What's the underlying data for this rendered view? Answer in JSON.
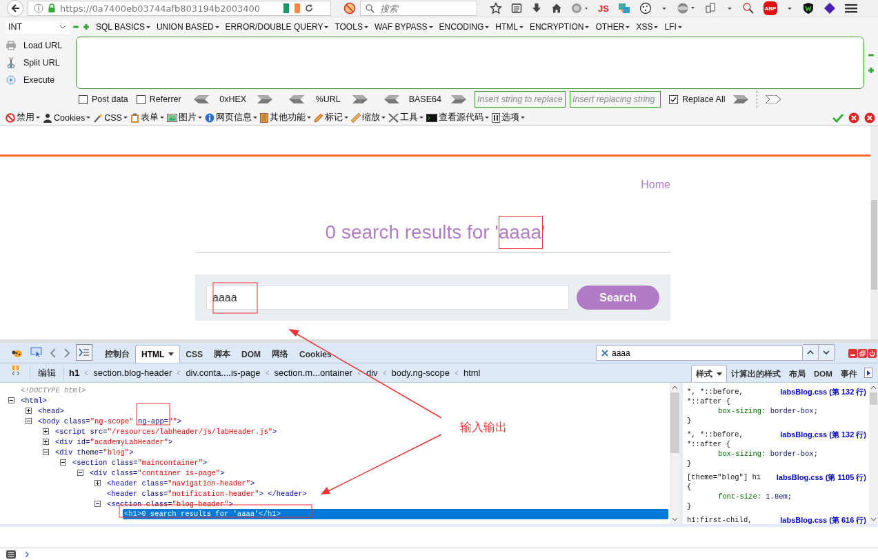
{
  "browser": {
    "url": "https://0a7400eb03744afb803194b2003400",
    "search_placeholder": "搜索",
    "addon_labels": [
      "JS",
      "ABP"
    ]
  },
  "hackbar": {
    "type_select": "INT",
    "menus": [
      "SQL BASICS",
      "UNION BASED",
      "ERROR/DOUBLE QUERY",
      "TOOLS",
      "WAF BYPASS",
      "ENCODING",
      "HTML",
      "ENCRYPTION",
      "OTHER",
      "XSS",
      "LFI"
    ],
    "actions": [
      {
        "label": "Load URL",
        "kind": "load"
      },
      {
        "label": "Split URL",
        "kind": "split"
      },
      {
        "label": "Execute",
        "kind": "execute"
      }
    ],
    "checkboxes": [
      {
        "label": "Post data",
        "checked": false
      },
      {
        "label": "Referrer",
        "checked": false
      }
    ],
    "encoders": [
      "0xHEX",
      "%URL",
      "BASE64"
    ],
    "replace_placeholders": [
      "Insert string to replace",
      "Insert replacing string"
    ],
    "replace_all": {
      "label": "Replace All",
      "checked": true
    }
  },
  "webdev_toolbar": [
    {
      "label": "禁用",
      "kind": "disable"
    },
    {
      "label": "Cookies",
      "kind": "cookies"
    },
    {
      "label": "CSS",
      "kind": "css"
    },
    {
      "label": "表单",
      "kind": "forms"
    },
    {
      "label": "图片",
      "kind": "images"
    },
    {
      "label": "网页信息",
      "kind": "info"
    },
    {
      "label": "其他功能",
      "kind": "misc"
    },
    {
      "label": "标记",
      "kind": "outline"
    },
    {
      "label": "缩放",
      "kind": "resize"
    },
    {
      "label": "工具",
      "kind": "tools"
    },
    {
      "label": "查看源代码",
      "kind": "source"
    },
    {
      "label": "选项",
      "kind": "options"
    }
  ],
  "page": {
    "nav_link": "Home",
    "heading": "0 search results for 'aaaa'",
    "search_value": "aaaa",
    "search_button": "Search"
  },
  "devtools": {
    "tabs": [
      {
        "label": "控制台",
        "selected": false,
        "menu": false
      },
      {
        "label": "HTML",
        "selected": true,
        "menu": true
      },
      {
        "label": "CSS",
        "selected": false,
        "menu": false
      },
      {
        "label": "脚本",
        "selected": false,
        "menu": false
      },
      {
        "label": "DOM",
        "selected": false,
        "menu": false
      },
      {
        "label": "网络",
        "selected": false,
        "menu": false
      },
      {
        "label": "Cookies",
        "selected": false,
        "menu": false
      }
    ],
    "search_value": "aaaa",
    "edit_button": "编辑",
    "breadcrumbs": [
      {
        "label": "h1",
        "selected": true
      },
      {
        "label": "section.blog-header",
        "selected": false
      },
      {
        "label": "div.conta....is-page",
        "selected": false
      },
      {
        "label": "section.m...ontainer",
        "selected": false
      },
      {
        "label": "div",
        "selected": false
      },
      {
        "label": "body.ng-scope",
        "selected": false
      },
      {
        "label": "html",
        "selected": false
      }
    ],
    "side_tabs": [
      {
        "label": "样式",
        "selected": true,
        "menu": true
      },
      {
        "label": "计算出的样式",
        "selected": false,
        "menu": false
      },
      {
        "label": "布局",
        "selected": false,
        "menu": false
      },
      {
        "label": "DOM",
        "selected": false,
        "menu": false
      },
      {
        "label": "事件",
        "selected": false,
        "menu": false
      }
    ],
    "tree": [
      {
        "line": [
          {
            "text": "<!DOCTYPE html>",
            "kind": "doctype"
          }
        ],
        "selected": false
      },
      {
        "line": [
          {
            "text": "<html>",
            "kind": "tag"
          }
        ],
        "expanded": true,
        "selected": false,
        "children": [
          {
            "line": [
              {
                "text": "<head>",
                "kind": "tag"
              }
            ],
            "expanded": false,
            "selected": false
          },
          {
            "line": [
              {
                "text": "<body",
                "kind": "tag"
              },
              {
                "text": "class=",
                "kind": "attr"
              },
              {
                "text": "\"ng-scope\"",
                "kind": "value"
              },
              {
                "text": "ng-app=",
                "kind": "attr"
              },
              {
                "text": "\"\"",
                "kind": "value"
              },
              {
                "text": ">",
                "kind": "tag"
              }
            ],
            "expanded": true,
            "selected": false,
            "children": [
              {
                "line": [
                  {
                    "text": "<script",
                    "kind": "tag"
                  },
                  {
                    "text": "src=",
                    "kind": "attr"
                  },
                  {
                    "text": "\"/resources/labheader/js/labHeader.js\"",
                    "kind": "value"
                  },
                  {
                    "text": ">",
                    "kind": "tag"
                  }
                ],
                "expanded": false,
                "selected": false
              },
              {
                "line": [
                  {
                    "text": "<div",
                    "kind": "tag"
                  },
                  {
                    "text": "id=",
                    "kind": "attr"
                  },
                  {
                    "text": "\"academyLabHeader\"",
                    "kind": "value"
                  },
                  {
                    "text": ">",
                    "kind": "tag"
                  }
                ],
                "expanded": false,
                "selected": false
              },
              {
                "line": [
                  {
                    "text": "<div",
                    "kind": "tag"
                  },
                  {
                    "text": "theme=",
                    "kind": "attr"
                  },
                  {
                    "text": "\"blog\"",
                    "kind": "value"
                  },
                  {
                    "text": ">",
                    "kind": "tag"
                  }
                ],
                "expanded": true,
                "selected": false,
                "children": [
                  {
                    "line": [
                      {
                        "text": "<section",
                        "kind": "tag"
                      },
                      {
                        "text": "class=",
                        "kind": "attr"
                      },
                      {
                        "text": "\"maincontainer\"",
                        "kind": "value"
                      },
                      {
                        "text": ">",
                        "kind": "tag"
                      }
                    ],
                    "expanded": true,
                    "selected": false,
                    "children": [
                      {
                        "line": [
                          {
                            "text": "<div",
                            "kind": "tag"
                          },
                          {
                            "text": "class=",
                            "kind": "attr"
                          },
                          {
                            "text": "\"container is-page\"",
                            "kind": "value"
                          },
                          {
                            "text": ">",
                            "kind": "tag"
                          }
                        ],
                        "expanded": true,
                        "selected": false,
                        "children": [
                          {
                            "line": [
                              {
                                "text": "<header",
                                "kind": "tag"
                              },
                              {
                                "text": "class=",
                                "kind": "attr"
                              },
                              {
                                "text": "\"navigation-header\"",
                                "kind": "value"
                              },
                              {
                                "text": ">",
                                "kind": "tag"
                              }
                            ],
                            "expanded": false,
                            "selected": false
                          },
                          {
                            "line": [
                              {
                                "text": "<header",
                                "kind": "tag"
                              },
                              {
                                "text": "class=",
                                "kind": "attr"
                              },
                              {
                                "text": "\"notification-header\"",
                                "kind": "value"
                              },
                              {
                                "text": ">",
                                "kind": "tag"
                              },
                              {
                                "text": "</header>",
                                "kind": "tag"
                              }
                            ],
                            "selected": false
                          },
                          {
                            "line": [
                              {
                                "text": "<section",
                                "kind": "tag"
                              },
                              {
                                "text": "class=",
                                "kind": "attr"
                              },
                              {
                                "text": "\"blog-header\"",
                                "kind": "value"
                              },
                              {
                                "text": ">",
                                "kind": "tag"
                              }
                            ],
                            "expanded": true,
                            "selected": false,
                            "children": [
                              {
                                "line": [
                                  {
                                    "text": "<h1>",
                                    "kind": "tag"
                                  },
                                  {
                                    "text": "0 search results for 'aaaa'",
                                    "kind": "text"
                                  },
                                  {
                                    "text": "</h1>",
                                    "kind": "tag"
                                  }
                                ],
                                "selected": true
                              }
                            ]
                          }
                        ]
                      }
                    ]
                  }
                ]
              }
            ]
          }
        ]
      }
    ],
    "css_rules": [
      {
        "selector": [
          "*, *::before,",
          "*::after {"
        ],
        "source": "labsBlog.css (第 132 行)",
        "declarations": [
          {
            "property": "box-sizing:",
            "value": "border-box;"
          }
        ],
        "closing": "}"
      },
      {
        "selector": [
          "*, *::before,",
          "*::after {"
        ],
        "source": "labsBlog.css (第 132 行)",
        "declarations": [
          {
            "property": "box-sizing:",
            "value": "border-box;"
          }
        ],
        "closing": "}"
      },
      {
        "selector": [
          "[theme=\"blog\"] h1",
          "{"
        ],
        "source": "labsBlog.css (第 1105 行)",
        "declarations": [
          {
            "property": "font-size:",
            "value": "1.8em;"
          }
        ],
        "closing": "}"
      },
      {
        "selector": [
          "h1:first-child,"
        ],
        "source": "labsBlog.css (第 616 行)"
      }
    ]
  },
  "annotation": {
    "label": "输入输出"
  }
}
